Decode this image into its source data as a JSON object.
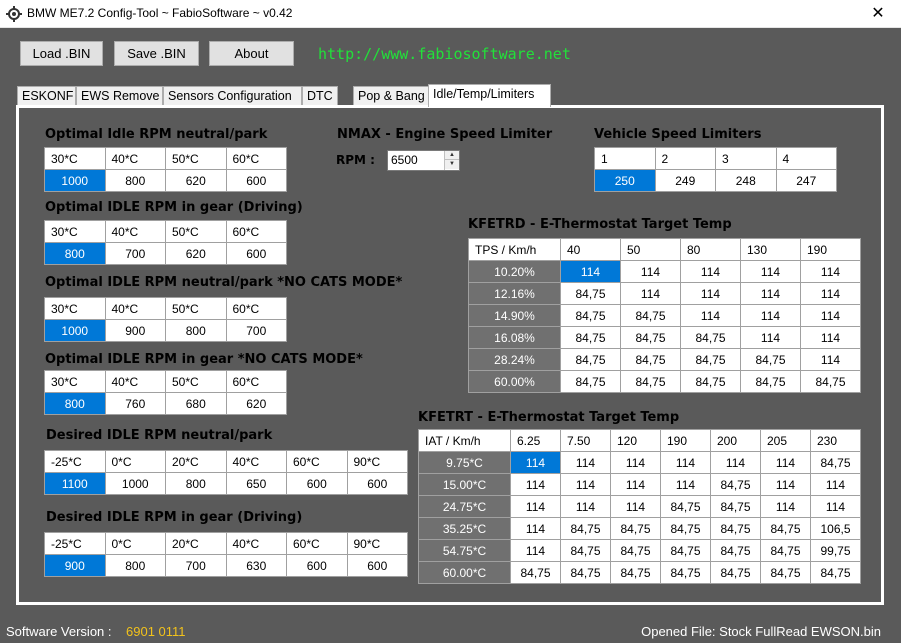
{
  "window": {
    "title": "BMW ME7.2 Config-Tool ~ FabioSoftware ~ v0.42",
    "close_glyph": "✕"
  },
  "toolbar": {
    "load_label": "Load .BIN",
    "save_label": "Save .BIN",
    "about_label": "About",
    "website": "http://www.fabiosoftware.net"
  },
  "tabs": [
    "ESKONF",
    "EWS Remove",
    "Sensors Configuration",
    "DTC",
    "Pop & Bang",
    "Idle/Temp/Limiters"
  ],
  "sections": {
    "idle_neutral": {
      "title": "Optimal Idle RPM neutral/park",
      "headers": [
        "30*C",
        "40*C",
        "50*C",
        "60*C"
      ],
      "values": [
        "1000",
        "800",
        "620",
        "600"
      ]
    },
    "idle_gear": {
      "title": "Optimal IDLE RPM in gear (Driving)",
      "headers": [
        "30*C",
        "40*C",
        "50*C",
        "60*C"
      ],
      "values": [
        "800",
        "700",
        "620",
        "600"
      ]
    },
    "idle_neutral_nocats": {
      "title": "Optimal IDLE RPM neutral/park *NO CATS MODE*",
      "headers": [
        "30*C",
        "40*C",
        "50*C",
        "60*C"
      ],
      "values": [
        "1000",
        "900",
        "800",
        "700"
      ]
    },
    "idle_gear_nocats": {
      "title": "Optimal IDLE RPM in gear *NO CATS MODE*",
      "headers": [
        "30*C",
        "40*C",
        "50*C",
        "60*C"
      ],
      "values": [
        "800",
        "760",
        "680",
        "620"
      ]
    },
    "desired_neutral": {
      "title": "Desired IDLE RPM neutral/park",
      "headers": [
        "-25*C",
        "0*C",
        "20*C",
        "40*C",
        "60*C",
        "90*C"
      ],
      "values": [
        "1100",
        "1000",
        "800",
        "650",
        "600",
        "600"
      ]
    },
    "desired_gear": {
      "title": "Desired IDLE RPM in gear (Driving)",
      "headers": [
        "-25*C",
        "0*C",
        "20*C",
        "40*C",
        "60*C",
        "90*C"
      ],
      "values": [
        "900",
        "800",
        "700",
        "630",
        "600",
        "600"
      ]
    },
    "nmax": {
      "title": "NMAX - Engine Speed Limiter",
      "rpm_label": "RPM :",
      "rpm_value": "6500"
    },
    "vehicle_speed": {
      "title": "Vehicle Speed Limiters",
      "headers": [
        "1",
        "2",
        "3",
        "4"
      ],
      "values": [
        "250",
        "249",
        "248",
        "247"
      ]
    },
    "kfetrd": {
      "title": "KFETRD - E-Thermostat Target Temp",
      "corner": "TPS / Km/h",
      "col_headers": [
        "40",
        "50",
        "80",
        "130",
        "190"
      ],
      "rows": [
        {
          "label": "10.20%",
          "cells": [
            "114",
            "114",
            "114",
            "114",
            "114"
          ]
        },
        {
          "label": "12.16%",
          "cells": [
            "84,75",
            "114",
            "114",
            "114",
            "114"
          ]
        },
        {
          "label": "14.90%",
          "cells": [
            "84,75",
            "84,75",
            "114",
            "114",
            "114"
          ]
        },
        {
          "label": "16.08%",
          "cells": [
            "84,75",
            "84,75",
            "84,75",
            "114",
            "114"
          ]
        },
        {
          "label": "28.24%",
          "cells": [
            "84,75",
            "84,75",
            "84,75",
            "84,75",
            "114"
          ]
        },
        {
          "label": "60.00%",
          "cells": [
            "84,75",
            "84,75",
            "84,75",
            "84,75",
            "84,75"
          ]
        }
      ]
    },
    "kfetrt": {
      "title": "KFETRT - E-Thermostat Target Temp",
      "corner": "IAT / Km/h",
      "col_headers": [
        "6.25",
        "7.50",
        "120",
        "190",
        "200",
        "205",
        "230"
      ],
      "rows": [
        {
          "label": "9.75*C",
          "cells": [
            "114",
            "114",
            "114",
            "114",
            "114",
            "114",
            "84,75"
          ]
        },
        {
          "label": "15.00*C",
          "cells": [
            "114",
            "114",
            "114",
            "114",
            "84,75",
            "114",
            "114"
          ]
        },
        {
          "label": "24.75*C",
          "cells": [
            "114",
            "114",
            "114",
            "84,75",
            "84,75",
            "114",
            "114"
          ]
        },
        {
          "label": "35.25*C",
          "cells": [
            "114",
            "84,75",
            "84,75",
            "84,75",
            "84,75",
            "84,75",
            "106,5"
          ]
        },
        {
          "label": "54.75*C",
          "cells": [
            "114",
            "84,75",
            "84,75",
            "84,75",
            "84,75",
            "84,75",
            "99,75"
          ]
        },
        {
          "label": "60.00*C",
          "cells": [
            "84,75",
            "84,75",
            "84,75",
            "84,75",
            "84,75",
            "84,75",
            "84,75"
          ]
        }
      ]
    }
  },
  "footer": {
    "version_label": "Software Version :",
    "version_value": "6901 0111",
    "opened_file": "Opened File: Stock FullRead EWSON.bin"
  },
  "colors": {
    "selected_cell": "#0078d7",
    "row_header": "#707070",
    "link": "#22e03a",
    "version": "#f2c21b",
    "background": "#5a5a5a"
  }
}
